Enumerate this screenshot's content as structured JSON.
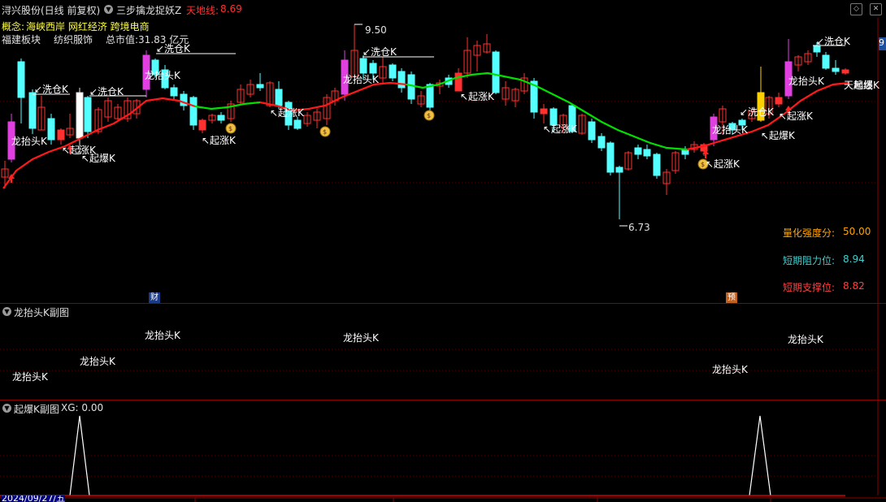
{
  "header": {
    "stock": "浔兴股份(日线 前复权)",
    "formula": "三步擒龙捉妖Z",
    "tiandi_label": "天地线:",
    "tiandi_value": "8.69",
    "concept_label": "概念:",
    "concepts": "海峡西岸 网红经济 跨境电商",
    "region": "福建板块",
    "industry": "纺织服饰",
    "market_cap": "总市值:31.83 亿元"
  },
  "main_chart": {
    "high_label": "9.50",
    "low_label": "6.73",
    "right_edge_label": "9",
    "stats": [
      {
        "label": "量化强度分:",
        "value": "50.00",
        "color": "#ffa500"
      },
      {
        "label": "短期阻力位:",
        "value": "8.94",
        "color": "#3fd0d0"
      },
      {
        "label": "短期支撑位:",
        "value": "8.82",
        "color": "#ff4040"
      }
    ],
    "markers": {
      "xicang": "洗仓K",
      "longtaitou": "龙抬头K",
      "qizhang": "起涨K",
      "qibao": "起爆K",
      "tiandi_end": "天地线",
      "qibao_end": "起爆K"
    },
    "badge_cai": "财",
    "badge_yu": "预"
  },
  "panel2": {
    "title": "龙抬头K副图",
    "label": "龙抬头K"
  },
  "panel3": {
    "title": "起爆K副图",
    "xg": "XG: 0.00"
  },
  "footer": {
    "date": "2024/09/27/五"
  },
  "colors": {
    "up": "#ff3030",
    "down": "#54ffff",
    "magenta": "#e040e0",
    "ma_red": "#ff1a1a",
    "ma_green": "#00e000",
    "grid": "#8b0000"
  }
}
